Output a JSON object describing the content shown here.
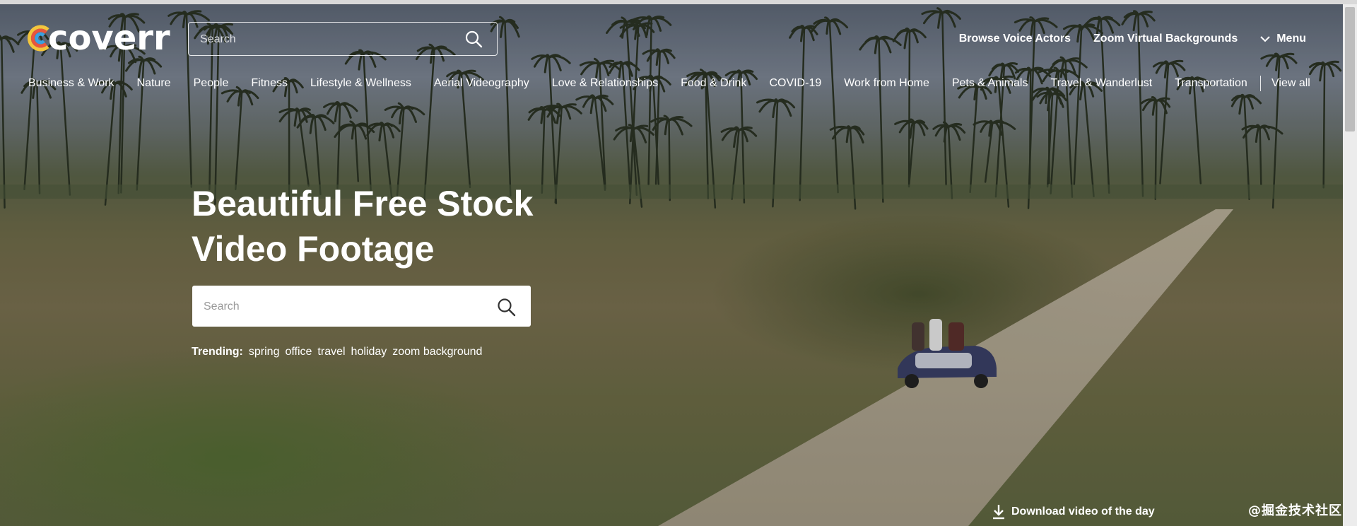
{
  "brand": {
    "name": "coverr"
  },
  "header": {
    "search_placeholder": "Search",
    "links": [
      {
        "label": "Browse Voice Actors"
      },
      {
        "label": "Zoom Virtual Backgrounds"
      }
    ],
    "menu_label": "Menu"
  },
  "categories": [
    "Business & Work",
    "Nature",
    "People",
    "Fitness",
    "Lifestyle & Wellness",
    "Aerial Videography",
    "Love & Relationships",
    "Food & Drink",
    "COVID-19",
    "Work from Home",
    "Pets & Animals",
    "Travel & Wanderlust",
    "Transportation"
  ],
  "view_all_label": "View all",
  "hero": {
    "title_line1": "Beautiful Free Stock",
    "title_line2": "Video Footage",
    "search_placeholder": "Search",
    "trending_label": "Trending:",
    "trending_tags": [
      "spring",
      "office",
      "travel",
      "holiday",
      "zoom background"
    ]
  },
  "download_label": "Download video of the day",
  "watermark": "@掘金技术社区",
  "icons": {
    "search": "search-icon",
    "menu": "chevron-down-icon",
    "download": "download-icon"
  }
}
